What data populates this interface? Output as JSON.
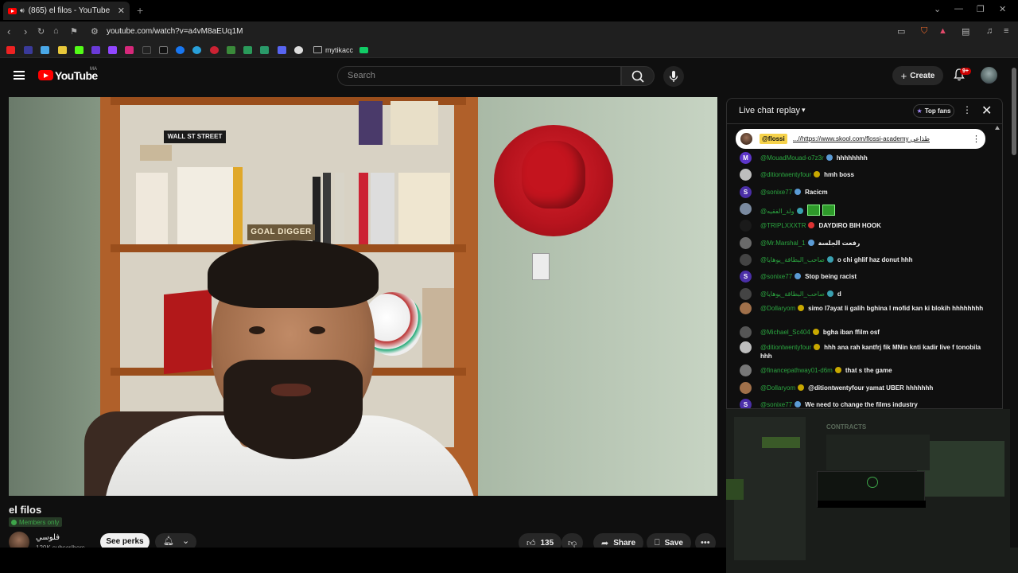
{
  "browser": {
    "tab_title": "(865) el filos - YouTube",
    "tab_close": "✕",
    "new_tab": "+",
    "url": "youtube.com/watch?v=a4vM8aEUq1M",
    "bookmark_folder_label": "mytikacc"
  },
  "header": {
    "logo_text": "YouTube",
    "country_code": "MA",
    "search_placeholder": "Search",
    "create_label": "Create",
    "notification_count": "9+"
  },
  "video": {
    "title": "el filos",
    "members_badge": "Members only",
    "channel_name": "فلوسي",
    "channel_subs": "120K subscribers",
    "see_perks_label": "See perks",
    "like_count": "135",
    "share_label": "Share",
    "save_label": "Save",
    "scene_sign_goal": "GOAL DIGGER",
    "scene_sign_wall": "WALL ST STREET"
  },
  "chat": {
    "header_title": "Live chat replay",
    "top_fans_label": "Top fans",
    "pinned": {
      "user": "@flossi",
      "text": "...//https://www.skool.com/flossi-academy طذاعي"
    },
    "messages": [
      {
        "user": "@MouadMouad-o7z3r",
        "text": "hhhhhhhh",
        "avatar_letter": "M",
        "avatar_color": "#5c35c8",
        "badge_color": "#5b9bd5",
        "emote": false
      },
      {
        "user": "@ditiontwentyfour",
        "text": "hmh boss",
        "avatar_letter": "",
        "avatar_color": "#bdbdbd",
        "badge_color": "#c8a800",
        "emote": false
      },
      {
        "user": "@sonixe77",
        "text": "Racicm",
        "avatar_letter": "S",
        "avatar_color": "#4b2fa8",
        "badge_color": "#5b9bd5",
        "emote": false
      },
      {
        "user": "@ولد_الفقيه",
        "text": "",
        "avatar_letter": "",
        "avatar_color": "#7a8aa0",
        "badge_color": "#3aa0b0",
        "emote": true
      },
      {
        "user": "@TRIPLXXXTR",
        "text": "DAYDIRO BIH HOOK",
        "avatar_letter": "",
        "avatar_color": "#1a1a1a",
        "badge_color": "#d33",
        "emote": false
      },
      {
        "user": "@Mr.Marshal_1",
        "text": "رفعت الجلسة",
        "avatar_letter": "",
        "avatar_color": "#6a6a6a",
        "badge_color": "#5b9bd5",
        "emote": false
      },
      {
        "user": "@صاحب_البطاقة_يوهايا",
        "text": "o chi ghlif haz donut hhh",
        "avatar_letter": "",
        "avatar_color": "#444",
        "badge_color": "#3aa0b0",
        "emote": false
      },
      {
        "user": "@sonixe77",
        "text": "Stop being racist",
        "avatar_letter": "S",
        "avatar_color": "#4b2fa8",
        "badge_color": "#5b9bd5",
        "emote": false
      },
      {
        "user": "@صاحب_البطاقة_يوهايا",
        "text": "d",
        "avatar_letter": "",
        "avatar_color": "#444",
        "badge_color": "#3aa0b0",
        "emote": false
      },
      {
        "user": "@Dollaryom",
        "text": "simo l7ayat li galih bghina l mofid kan ki blokih hhhhhhhh",
        "avatar_letter": "",
        "avatar_color": "#a0704a",
        "badge_color": "#c8a800",
        "emote": false
      },
      {
        "user": "@Michael_Sc404",
        "text": "bgha iban ffilm osf",
        "avatar_letter": "",
        "avatar_color": "#555",
        "badge_color": "#c8a800",
        "emote": false
      },
      {
        "user": "@ditiontwentyfour",
        "text": "hhh ana rah kantfrj fik MNin knti kadir live f tonobila hhh",
        "avatar_letter": "",
        "avatar_color": "#bdbdbd",
        "badge_color": "#c8a800",
        "emote": false
      },
      {
        "user": "@financepathway01-d6m",
        "text": "that s the game",
        "avatar_letter": "",
        "avatar_color": "#777",
        "badge_color": "#c8a800",
        "emote": false
      },
      {
        "user": "@Dollaryom",
        "text": "@ditiontwentyfour yamat UBER hhhhhhh",
        "avatar_letter": "",
        "avatar_color": "#a0704a",
        "badge_color": "#c8a800",
        "emote": false
      },
      {
        "user": "@sonixe77",
        "text": "We need to change the films industry",
        "avatar_letter": "S",
        "avatar_color": "#4b2fa8",
        "badge_color": "#5b9bd5",
        "emote": false
      }
    ]
  },
  "side": {
    "dim_label": "CONTRACTS"
  }
}
